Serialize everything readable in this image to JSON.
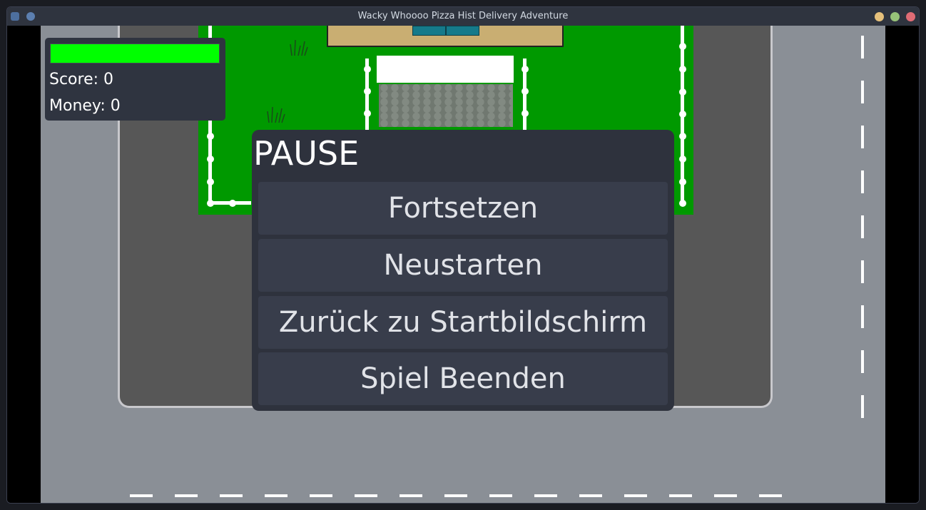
{
  "window": {
    "title": "Wacky Whoooo Pizza Hist Delivery Adventure"
  },
  "hud": {
    "health_fraction": 1.0,
    "health_color": "#00ff00",
    "score_label": "Score: 0",
    "money_label": "Money: 0"
  },
  "pause_menu": {
    "title": "PAUSE",
    "buttons": [
      {
        "label": "Fortsetzen"
      },
      {
        "label": "Neustarten"
      },
      {
        "label": "Zurück zu Startbildschirm"
      },
      {
        "label": "Spiel Beenden"
      }
    ]
  },
  "colors": {
    "road": "#8a8f96",
    "block": "#575757",
    "lawn": "#009900",
    "panel": "#2e323d",
    "button": "#383d4b"
  }
}
